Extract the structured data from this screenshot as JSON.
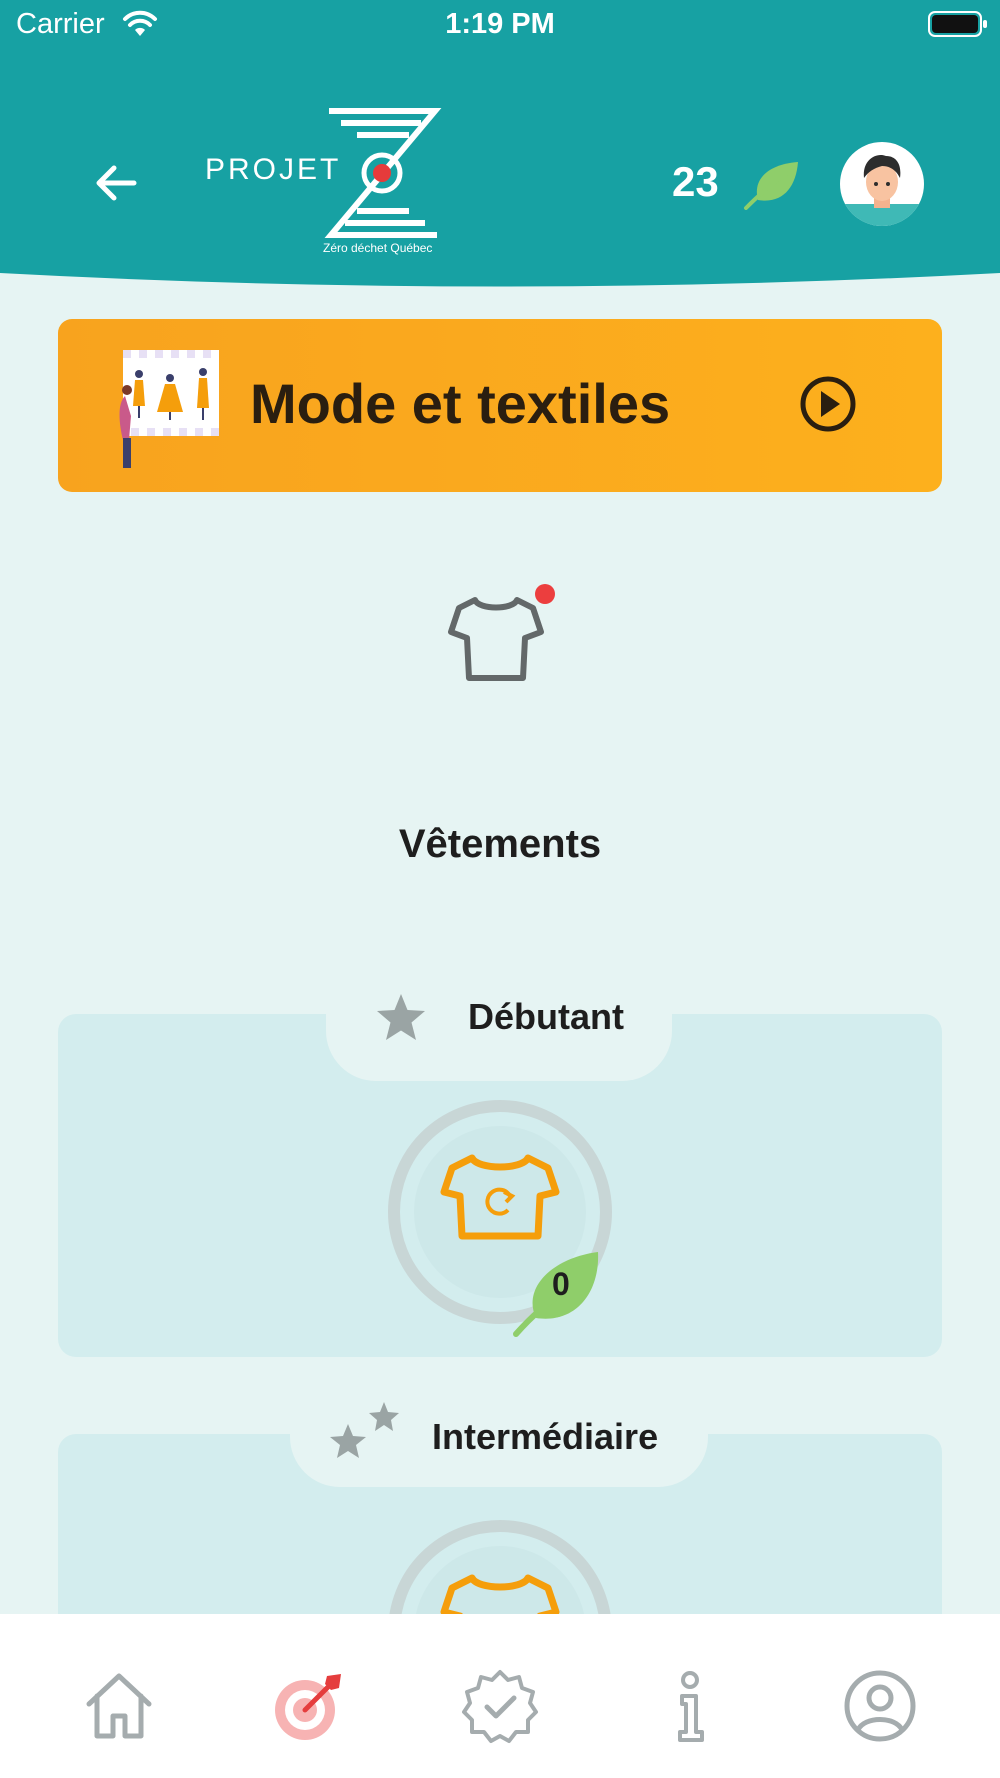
{
  "status_bar": {
    "carrier": "Carrier",
    "time": "1:19 PM"
  },
  "header": {
    "logo_text": "PROJET",
    "logo_subtitle": "Zéro déchet Québec",
    "points": "23",
    "colors": {
      "header_bg": "#17a1a3",
      "leaf": "#8fce6a"
    }
  },
  "category": {
    "title": "Mode et textiles",
    "color": "#f8a31e"
  },
  "subcategory": {
    "title": "Vêtements",
    "has_notification": true
  },
  "levels": [
    {
      "label": "Débutant",
      "stars": 1,
      "leaf_count": "0",
      "progress": 0
    },
    {
      "label": "Intermédiaire",
      "stars": 2,
      "progress": 0
    }
  ],
  "tabbar": {
    "active_index": 1,
    "items": [
      "home-icon",
      "target-icon",
      "badge-check-icon",
      "info-icon",
      "profile-icon"
    ]
  }
}
